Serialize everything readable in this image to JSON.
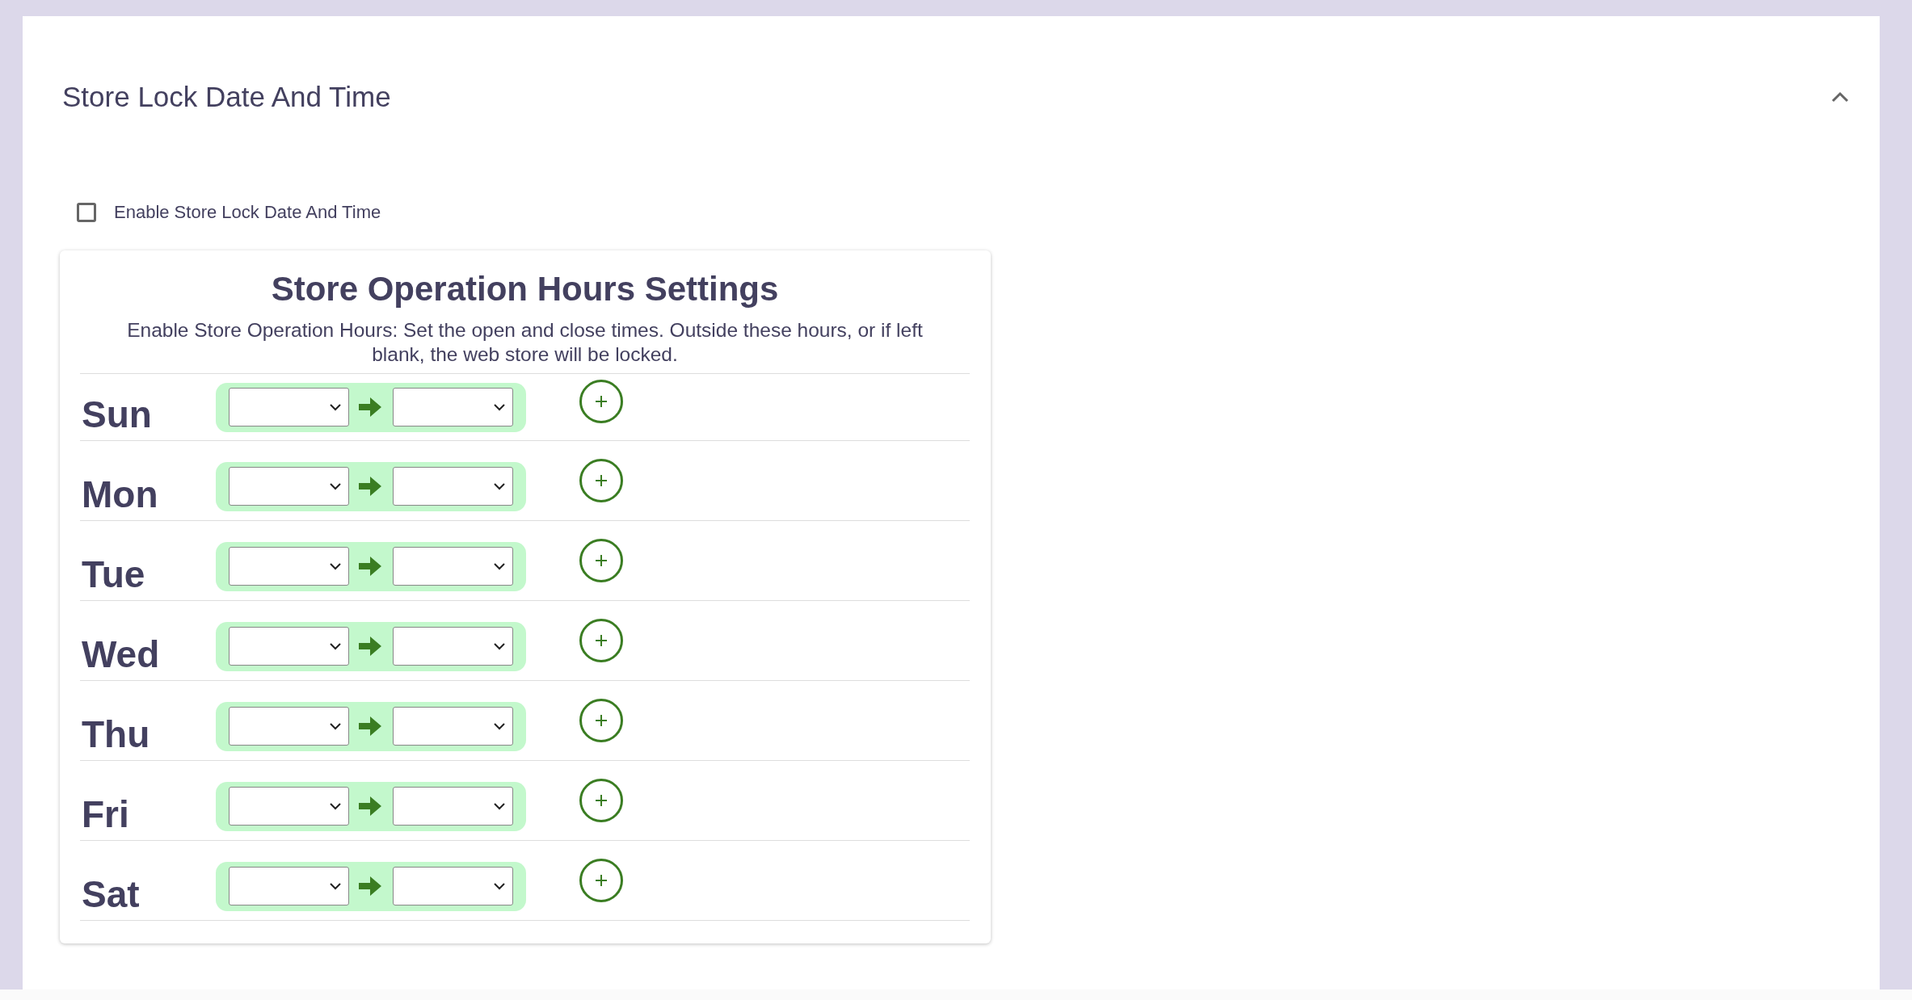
{
  "section": {
    "title": "Store Lock Date And Time",
    "expanded": true
  },
  "enable_lock": {
    "label": "Enable Store Lock Date And Time",
    "checked": false
  },
  "hours_card": {
    "title": "Store Operation Hours Settings",
    "description": "Enable Store Operation Hours: Set the open and close times. Outside these hours, or if left blank, the web store will be locked.",
    "days": [
      {
        "day": "Sun"
      },
      {
        "day": "Mon"
      },
      {
        "day": "Tue"
      },
      {
        "day": "Wed"
      },
      {
        "day": "Thu"
      },
      {
        "day": "Fri"
      },
      {
        "day": "Sat"
      }
    ]
  }
}
